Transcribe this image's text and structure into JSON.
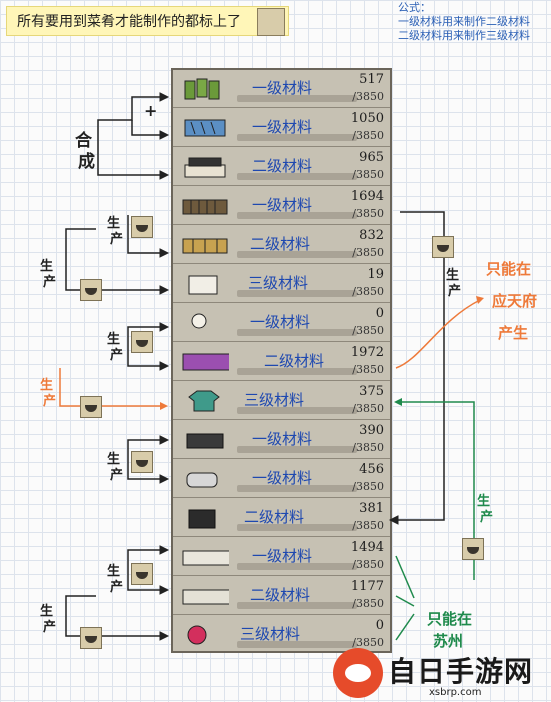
{
  "note": {
    "text": "所有要用到菜肴才能制作的都标上了"
  },
  "formula": {
    "title": "公式：",
    "line1": "一级材料用来制作二级材料",
    "line2": "二级材料用来制作三级材料"
  },
  "rows": [
    {
      "label": "一级材料",
      "count": "517",
      "max": "/3850"
    },
    {
      "label": "一级材料",
      "count": "1050",
      "max": "/3850"
    },
    {
      "label": "二级材料",
      "count": "965",
      "max": "/3850"
    },
    {
      "label": "一级材料",
      "count": "1694",
      "max": "/3850"
    },
    {
      "label": "二级材料",
      "count": "832",
      "max": "/3850"
    },
    {
      "label": "三级材料",
      "count": "19",
      "max": "/3850"
    },
    {
      "label": "一级材料",
      "count": "0",
      "max": "/3850"
    },
    {
      "label": "二级材料",
      "count": "1972",
      "max": "/3850"
    },
    {
      "label": "三级材料",
      "count": "375",
      "max": "/3850"
    },
    {
      "label": "一级材料",
      "count": "390",
      "max": "/3850"
    },
    {
      "label": "一级材料",
      "count": "456",
      "max": "/3850"
    },
    {
      "label": "二级材料",
      "count": "381",
      "max": "/3850"
    },
    {
      "label": "一级材料",
      "count": "1494",
      "max": "/3850"
    },
    {
      "label": "二级材料",
      "count": "1177",
      "max": "/3850"
    },
    {
      "label": "三级材料",
      "count": "0",
      "max": "/3850"
    }
  ],
  "annotations": {
    "plus": "+",
    "synth": [
      "合",
      "成"
    ],
    "produce": [
      "生",
      "产"
    ],
    "only_yingtian": [
      "只能在",
      "应天府",
      "产生"
    ],
    "only_suzhou": [
      "只能在",
      "苏州"
    ]
  },
  "colors": {
    "accent_orange": "#ee7a3a",
    "accent_green": "#1f8a4c",
    "label_blue": "#1e48b0"
  },
  "watermark": {
    "title": "自日手游网",
    "url": "xsbrp.com"
  }
}
